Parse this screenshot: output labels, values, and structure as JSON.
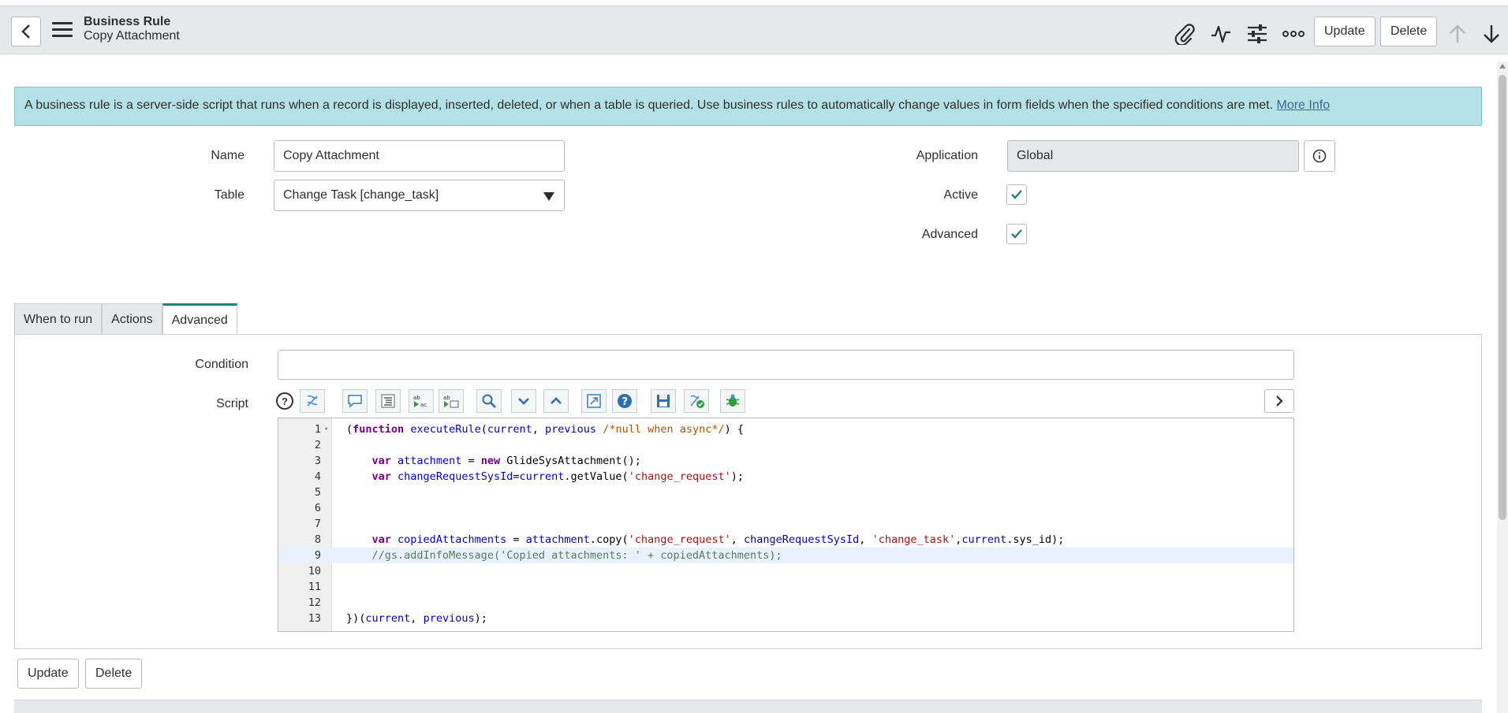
{
  "header": {
    "title": "Business Rule",
    "subtitle": "Copy Attachment",
    "update_label": "Update",
    "delete_label": "Delete",
    "icons": [
      "back-icon",
      "menu-icon",
      "paperclip-icon",
      "activity-icon",
      "settings-sliders-icon",
      "more-icon",
      "arrow-up-icon",
      "arrow-down-icon"
    ]
  },
  "banner": {
    "text": "A business rule is a server-side script that runs when a record is displayed, inserted, deleted, or when a table is queried. Use business rules to automatically change values in form fields when the specified conditions are met. ",
    "link": "More Info"
  },
  "form": {
    "name_label": "Name",
    "name_value": "Copy Attachment",
    "table_label": "Table",
    "table_value": "Change Task [change_task]",
    "application_label": "Application",
    "application_value": "Global",
    "active_label": "Active",
    "active_checked": true,
    "advanced_label": "Advanced",
    "advanced_checked": true
  },
  "tabs": [
    {
      "label": "When to run",
      "active": false
    },
    {
      "label": "Actions",
      "active": false
    },
    {
      "label": "Advanced",
      "active": true
    }
  ],
  "advanced": {
    "condition_label": "Condition",
    "condition_value": "",
    "script_label": "Script",
    "help_glyph": "?"
  },
  "script_lines": [
    "1",
    "2",
    "3",
    "4",
    "5",
    "6",
    "7",
    "8",
    "9",
    "10",
    "11",
    "12",
    "13"
  ],
  "bottom": {
    "update_label": "Update",
    "delete_label": "Delete"
  },
  "colors": {
    "banner_bg": "#b4e1e5",
    "header_bg": "#e6e8ea",
    "accent": "#1f8476",
    "link": "#3b6b8f"
  }
}
